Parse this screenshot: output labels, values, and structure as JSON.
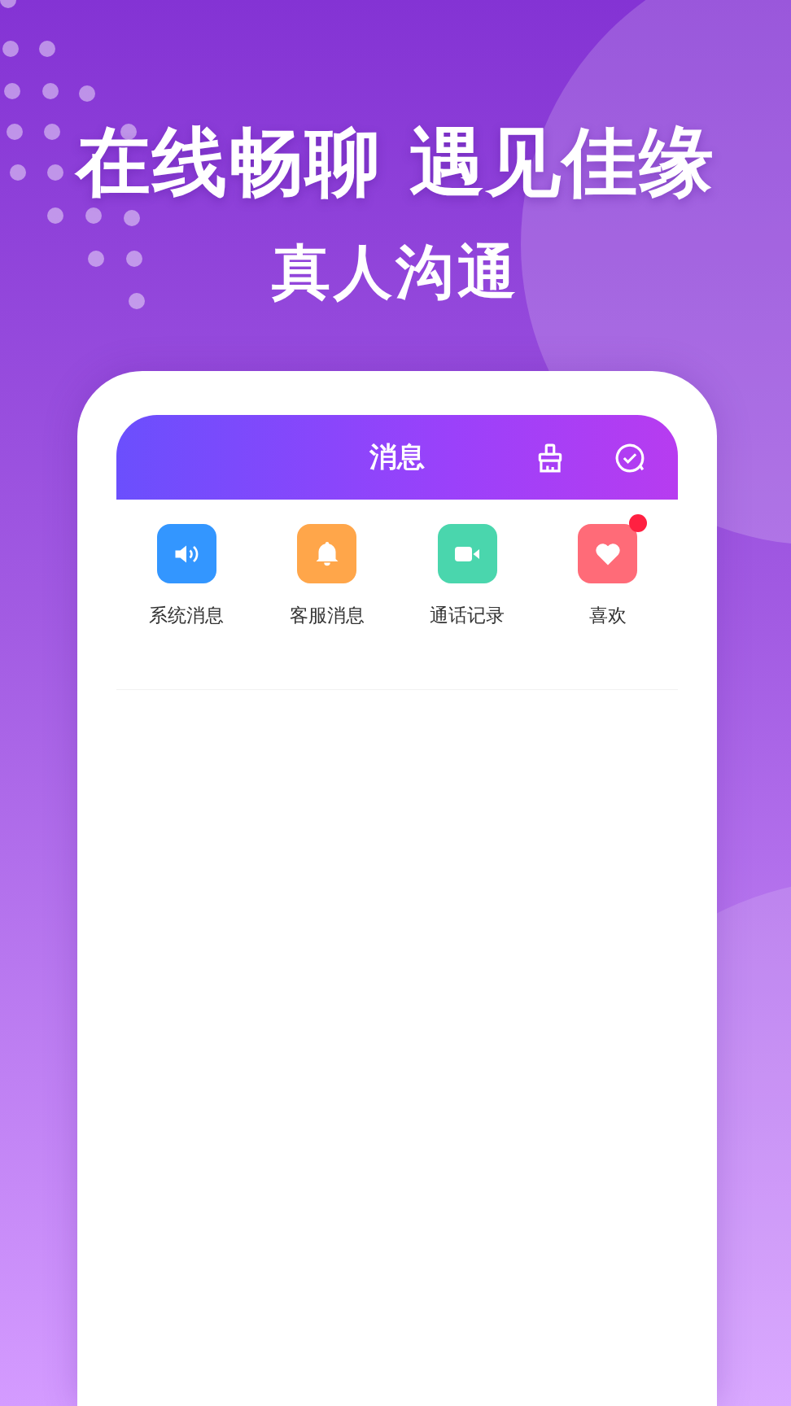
{
  "headline": "在线畅聊 遇见佳缘",
  "subheadline": "真人沟通",
  "screen": {
    "title": "消息",
    "actions": [
      {
        "kind": "clean"
      },
      {
        "kind": "check"
      }
    ],
    "shortcuts": [
      {
        "label": "系统消息",
        "kind": "speaker",
        "color": "#3396ff",
        "unread": false
      },
      {
        "label": "客服消息",
        "kind": "bell",
        "color": "#ffa64a",
        "unread": false
      },
      {
        "label": "通话记录",
        "kind": "video",
        "color": "#4ad6ad",
        "unread": false
      },
      {
        "label": "喜欢",
        "kind": "heart",
        "color": "#ff6b78",
        "unread": true
      }
    ]
  }
}
